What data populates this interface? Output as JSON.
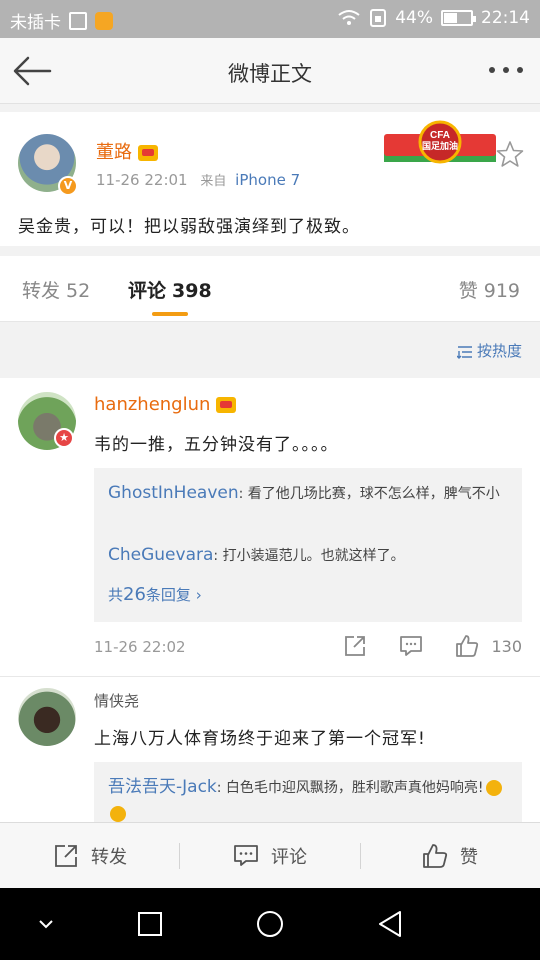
{
  "status_bar": {
    "carrier": "未插卡",
    "battery": "44%",
    "time": "22:14"
  },
  "nav": {
    "title": "微博正文"
  },
  "post": {
    "author": "董路",
    "time": "11-26 22:01",
    "source_prefix": "来自",
    "source": "iPhone 7",
    "content": "吴金贵，可以！把以弱敌强演绎到了极致。",
    "banner_text": "国足加油",
    "banner_badge": "CFA"
  },
  "tabs": {
    "repost_label": "转发",
    "repost_count": "52",
    "comment_label": "评论",
    "comment_count": "398",
    "like_label": "赞",
    "like_count": "919"
  },
  "sort": {
    "label": "按热度"
  },
  "comments": [
    {
      "name": "hanzhenglun",
      "text": "韦的一推，五分钟没有了。。。。",
      "replies": [
        {
          "name": "GhostInHeaven",
          "text": ": 看了他几场比赛，球不怎么样，脾气不小"
        },
        {
          "name": "CheGuevara",
          "text": ": 打小装逼范儿。也就这样了。"
        }
      ],
      "more_replies_prefix": "共",
      "more_replies_count": "26",
      "more_replies_suffix": "条回复",
      "time": "11-26 22:02",
      "likes": "130"
    },
    {
      "name": "情侠尧",
      "text": "上海八万人体育场终于迎来了第一个冠军!",
      "replies": [
        {
          "name": "吾法吾天-Jack",
          "text": ": 白色毛巾迎风飘扬，胜利歌声真他妈响亮!"
        }
      ]
    }
  ],
  "bottom_bar": {
    "repost": "转发",
    "comment": "评论",
    "like": "赞"
  },
  "colors": {
    "orange_name": "#e86b0f",
    "link_blue": "#4a7ab8",
    "tab_underline": "#f39c12"
  }
}
